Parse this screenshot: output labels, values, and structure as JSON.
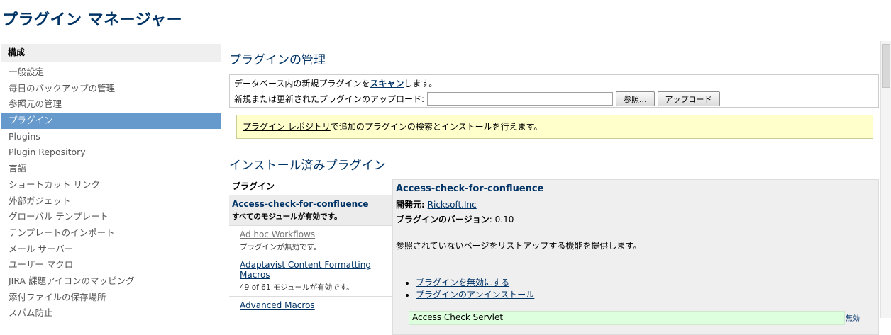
{
  "page": {
    "title": "プラグイン マネージャー"
  },
  "sidebar": {
    "heading": "構成",
    "items": [
      {
        "label": "一般設定",
        "active": false
      },
      {
        "label": "毎日のバックアップの管理",
        "active": false
      },
      {
        "label": "参照元の管理",
        "active": false
      },
      {
        "label": "プラグイン",
        "active": true
      },
      {
        "label": "Plugins",
        "active": false
      },
      {
        "label": "Plugin Repository",
        "active": false
      },
      {
        "label": "言語",
        "active": false
      },
      {
        "label": "ショートカット リンク",
        "active": false
      },
      {
        "label": "外部ガジェット",
        "active": false
      },
      {
        "label": "グローバル テンプレート",
        "active": false
      },
      {
        "label": "テンプレートのインポート",
        "active": false
      },
      {
        "label": "メール サーバー",
        "active": false
      },
      {
        "label": "ユーザー マクロ",
        "active": false
      },
      {
        "label": "JIRA 課題アイコンのマッピング",
        "active": false
      },
      {
        "label": "添付ファイルの保存場所",
        "active": false
      },
      {
        "label": "スパム防止",
        "active": false
      }
    ]
  },
  "manage": {
    "title": "プラグインの管理",
    "scan_prefix": "データベース内の新規プラグインを",
    "scan_link": "スキャン",
    "scan_suffix": "します。",
    "upload_label": "新規または更新されたプラグインのアップロード:",
    "browse_button": "参照...",
    "upload_button": "アップロード"
  },
  "notice": {
    "link": "プラグイン レポジトリ",
    "text": "で追加のプラグインの検索とインストールを行えます。"
  },
  "installed": {
    "title": "インストール済みプラグイン",
    "list_header": "プラグイン",
    "plugins": [
      {
        "name": "Access-check-for-confluence",
        "status": "すべてのモジュールが有効です。"
      },
      {
        "name": "Ad hoc Workflows",
        "status": "プラグインが無効です。"
      },
      {
        "name": "Adaptavist Content Formatting Macros",
        "status": "49 of 61 モジュールが有効です。"
      },
      {
        "name": "Advanced Macros",
        "status": ""
      }
    ]
  },
  "detail": {
    "name": "Access-check-for-confluence",
    "vendor_label": "開発元:",
    "vendor": "Ricksoft.Inc",
    "version_label": "プラグインのバージョン",
    "version": ": 0.10",
    "description": "参照されていないページをリストアップする機能を提供します。",
    "actions": [
      "プラグインを無効にする",
      "プラグインのアンインストール"
    ],
    "module": {
      "name": "Access Check Servlet",
      "status": "無効"
    }
  }
}
